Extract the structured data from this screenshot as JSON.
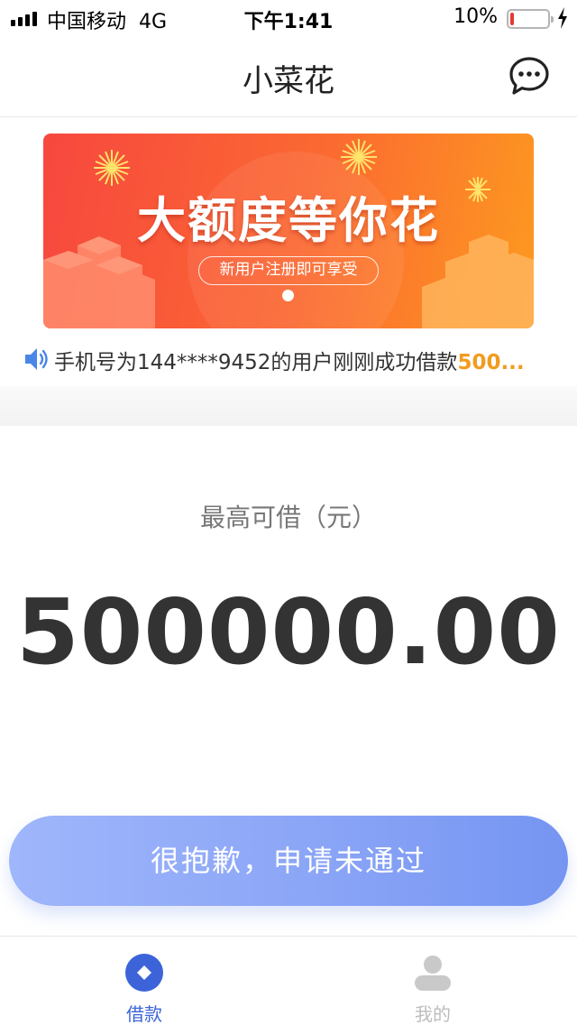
{
  "status_bar": {
    "carrier": "中国移动",
    "network": "4G",
    "time": "下午1:41",
    "battery_percent": "10%",
    "battery_level": 0.1,
    "battery_color": "#e53935"
  },
  "nav": {
    "title": "小菜花",
    "more_icon": "chat-bubble-more-icon"
  },
  "banner": {
    "headline": "大额度等你花",
    "subtext": "新用户注册即可享受",
    "colors": [
      "#f7473f",
      "#fd9920"
    ]
  },
  "notice": {
    "icon": "speaker-icon",
    "text": "手机号为144****9452的用户刚刚成功借款",
    "amount": "500..."
  },
  "loan": {
    "limit_label": "最高可借（元）",
    "limit_value": "500000.00",
    "status_button_label": "很抱歉，申请未通过"
  },
  "tab_bar": {
    "tabs": [
      {
        "label": "借款",
        "icon": "loan-diamond-icon",
        "active": true,
        "color": "#3c64d8"
      },
      {
        "label": "我的",
        "icon": "user-profile-icon",
        "active": false,
        "color": "#bdbdbd"
      }
    ]
  }
}
